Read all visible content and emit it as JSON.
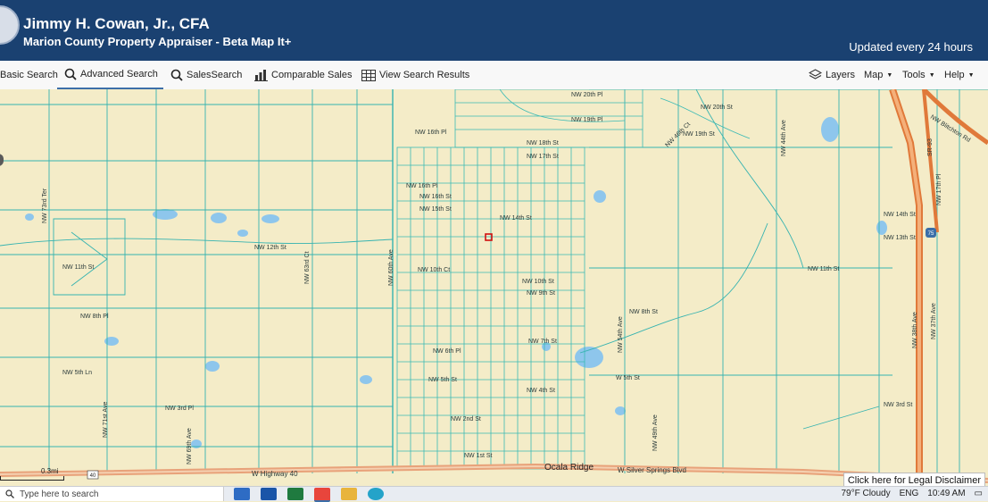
{
  "header": {
    "title": "Jimmy H. Cowan, Jr., CFA",
    "subtitle": "Marion County Property Appraiser - Beta Map It+",
    "updated": "Updated every 24 hours"
  },
  "toolbar": {
    "basic_search": "Basic Search",
    "advanced_search": "Advanced Search",
    "sales_search": "SalesSearch",
    "comparable_sales": "Comparable Sales",
    "view_results": "View Search Results",
    "layers": "Layers",
    "map": "Map",
    "tools": "Tools",
    "help": "Help"
  },
  "map": {
    "street_labels": {
      "nw_16th_pl_top": "NW 16th Pl",
      "nw_20th_pl": "NW 20th Pl",
      "nw_19th_pl": "NW 19th Pl",
      "nw_18th_st": "NW 18th St",
      "nw_17th_st": "NW 17th St",
      "nw_16th_pl": "NW 16th Pl",
      "nw_16th_st": "NW 16th St",
      "nw_15th_st": "NW 15th St",
      "nw_14th_st_w": "NW 14th St",
      "nw_14th_st_e": "NW 14th St",
      "nw_13th_st": "NW 13th St",
      "nw_12th_st": "NW 12th St",
      "nw_11th_st_w": "NW 11th St",
      "nw_11th_st_e": "NW 11th St",
      "nw_10th_st": "NW 10th St",
      "nw_10th_ct": "NW 10th Ct",
      "nw_9th_st": "NW 9th St",
      "nw_8th_pl_w": "NW 8th Pl",
      "nw_8th_st": "NW 8th St",
      "nw_7th_st": "NW 7th St",
      "nw_6th_pl": "NW 6th Pl",
      "nw_5th_ln": "NW 5th Ln",
      "nw_5th_st": "NW 5th St",
      "w_5th_st": "W 5th St",
      "nw_4th_st": "NW 4th St",
      "nw_3rd_pl_w": "NW 3rd Pl",
      "nw_3rd_st": "NW 3rd St",
      "nw_2nd_st": "NW 2nd St",
      "nw_1st_st": "NW 1st St",
      "nw_60th_ave": "NW 60th Ave",
      "nw_63rd_ct": "NW 63rd Ct",
      "nw_73rd_ter": "NW 73rd Ter",
      "nw_71st_ave": "NW 71st Ave",
      "nw_69th_ave": "NW 69th Ave",
      "nw_54th_ave": "NW 54th Ave",
      "nw_44th_ave": "NW 44th Ave",
      "nw_38th_ave": "NW 38th Ave",
      "nw_37th_ave": "NW 37th Ave",
      "nw_17th_pl": "NW 17th Pl",
      "sr_93": "SR-93",
      "nw_blitchton_rd": "NW Blitchton Rd",
      "nw_49th_ave": "NW 49th Ave",
      "nw_46th_ct": "NW 46th Ct",
      "nw_20th_st_ne": "NW 20th St",
      "nw_19th_st_ne": "NW 19th St",
      "w_highway_40": "W Highway 40",
      "ocala_ridge": "Ocala Ridge",
      "w_silver_springs": "W Silver Springs Blvd",
      "shield_40": "40",
      "shield_75": "75"
    },
    "scale": "0.3mi"
  },
  "disclaimer": "Click here for Legal Disclaimer",
  "taskbar": {
    "search_placeholder": "Type here to search",
    "weather": "79°F  Cloudy",
    "lang": "ENG",
    "time": "10:49 AM"
  },
  "colors": {
    "header_bg": "#1a4171",
    "map_bg": "#f4ecc8",
    "parcel_line": "#36b3b0",
    "highway": "#e0793a",
    "water": "#8ec6ec"
  }
}
